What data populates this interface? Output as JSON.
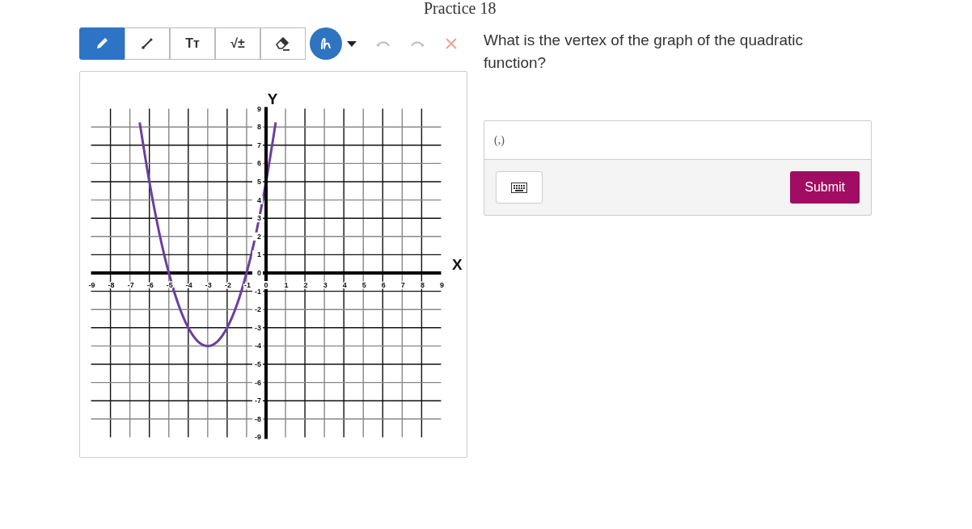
{
  "title": "Practice 18",
  "toolbar": {
    "tools": [
      {
        "kind": "pencil",
        "selected": true
      },
      {
        "kind": "line",
        "selected": false
      },
      {
        "kind": "glyph",
        "label": "Tт",
        "selected": false
      },
      {
        "kind": "glyph",
        "label": "√±",
        "selected": false
      },
      {
        "kind": "eraser",
        "selected": false
      }
    ],
    "pen": {
      "color": "#2e74c0"
    },
    "actions": [
      {
        "kind": "undo",
        "disabled": true
      },
      {
        "kind": "redo",
        "disabled": true
      },
      {
        "kind": "clear",
        "disabled": false
      }
    ]
  },
  "graph": {
    "chart_data": {
      "type": "line",
      "xlabel": "X",
      "ylabel": "Y",
      "x": [
        -6.5,
        -6,
        -5.5,
        -5,
        -4.5,
        -4,
        -3.5,
        -3,
        -2.5,
        -2,
        -1.5,
        -1,
        -0.5,
        0,
        0.5
      ],
      "series": [
        {
          "color": "#6b3fa0",
          "values": [
            8.25,
            5,
            2.25,
            0,
            -1.75,
            -3,
            -3.75,
            -4,
            -3.75,
            -3,
            -1.75,
            0,
            2.25,
            5,
            8.25
          ]
        }
      ],
      "grid": true,
      "xlim": [
        -9,
        9
      ],
      "ylim": [
        -9,
        9
      ],
      "xticks": [
        -9,
        -8,
        -7,
        -6,
        -5,
        -4,
        -3,
        -2,
        -1,
        0,
        1,
        2,
        3,
        4,
        5,
        6,
        7,
        8,
        9
      ],
      "yticks": [
        -9,
        -8,
        -7,
        -6,
        -5,
        -4,
        -3,
        -2,
        -1,
        0,
        1,
        2,
        3,
        4,
        5,
        6,
        7,
        8,
        9
      ]
    }
  },
  "question": "What is the vertex of the graph of the quadratic function?",
  "answer": {
    "value": "(,)"
  },
  "submit": "Submit"
}
